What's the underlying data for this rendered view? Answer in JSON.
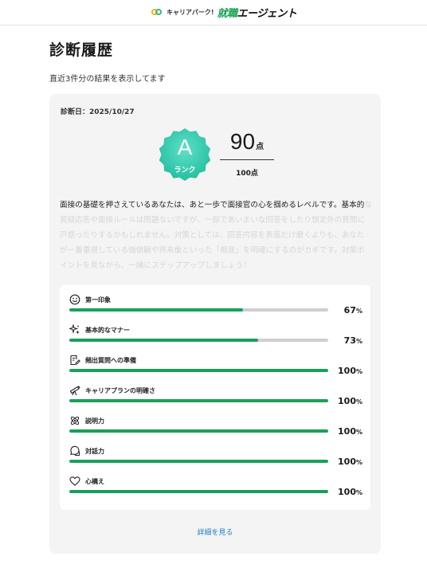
{
  "header": {
    "logo_small": "キャリアパーク!",
    "logo_big_green": "就職",
    "logo_big_black": "エージェント"
  },
  "page": {
    "title": "診断履歴",
    "subtitle": "直近3件分の結果を表示してます"
  },
  "result": {
    "date_label": "診断日：2025/10/27",
    "rank_letter": "A",
    "rank_label": "ランク",
    "score": "90",
    "score_unit": "点",
    "max_score": "100点",
    "description_visible": "面接の基礎を押さえているあなたは、あと一歩で面接官の心を掴めるレベルです。基本的",
    "description_faded": "な質疑応答や面接ルールは問題ないですが、一部であいまいな回答をしたり想定外の質問に戸惑ったりするかもしれません。対策としては、回答内容を表面だけ磨くよりも、あなたが一番重視している価値観や将来像といった「根底」を明確にするのがカギです。対策ポイントを見ながら、一緒にステップアップしましょう！",
    "detail_link": "詳細を見る",
    "colors": {
      "accent": "#18a05a",
      "badge": "#2ec5a8",
      "link": "#1f7fc4"
    },
    "metrics": [
      {
        "label": "第一印象",
        "percent": 67,
        "percent_text": "67",
        "icon": "smile-icon"
      },
      {
        "label": "基本的なマナー",
        "percent": 73,
        "percent_text": "73",
        "icon": "sparkle-icon"
      },
      {
        "label": "頻出質問への準備",
        "percent": 100,
        "percent_text": "100",
        "icon": "note-edit-icon"
      },
      {
        "label": "キャリアプランの明確さ",
        "percent": 100,
        "percent_text": "100",
        "icon": "telescope-icon"
      },
      {
        "label": "説明力",
        "percent": 100,
        "percent_text": "100",
        "icon": "atom-icon"
      },
      {
        "label": "対話力",
        "percent": 100,
        "percent_text": "100",
        "icon": "chat-icon"
      },
      {
        "label": "心構え",
        "percent": 100,
        "percent_text": "100",
        "icon": "heart-icon"
      }
    ],
    "percent_sign": "%"
  }
}
